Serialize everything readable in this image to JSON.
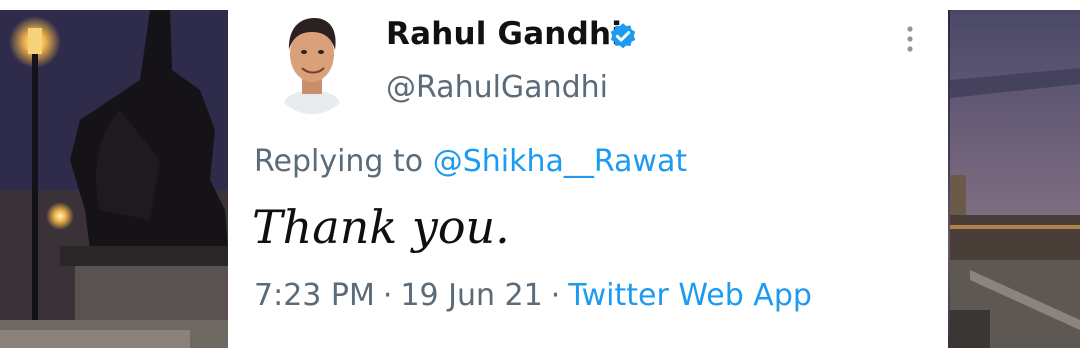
{
  "tweet": {
    "display_name": "Rahul Gandhi",
    "username": "@RahulGandhi",
    "replying_prefix": "Replying to",
    "reply_handle": "@Shikha__Rawat",
    "text": "Thank you.",
    "time": "7:23 PM",
    "separator": "·",
    "date": "19 Jun 21",
    "source": "Twitter Web App"
  },
  "icons": {
    "verified": "verified-badge-icon",
    "more": "more-options-icon"
  },
  "colors": {
    "link": "#1d9bf0",
    "secondary_text": "#5b6b78",
    "primary_text": "#111111"
  }
}
